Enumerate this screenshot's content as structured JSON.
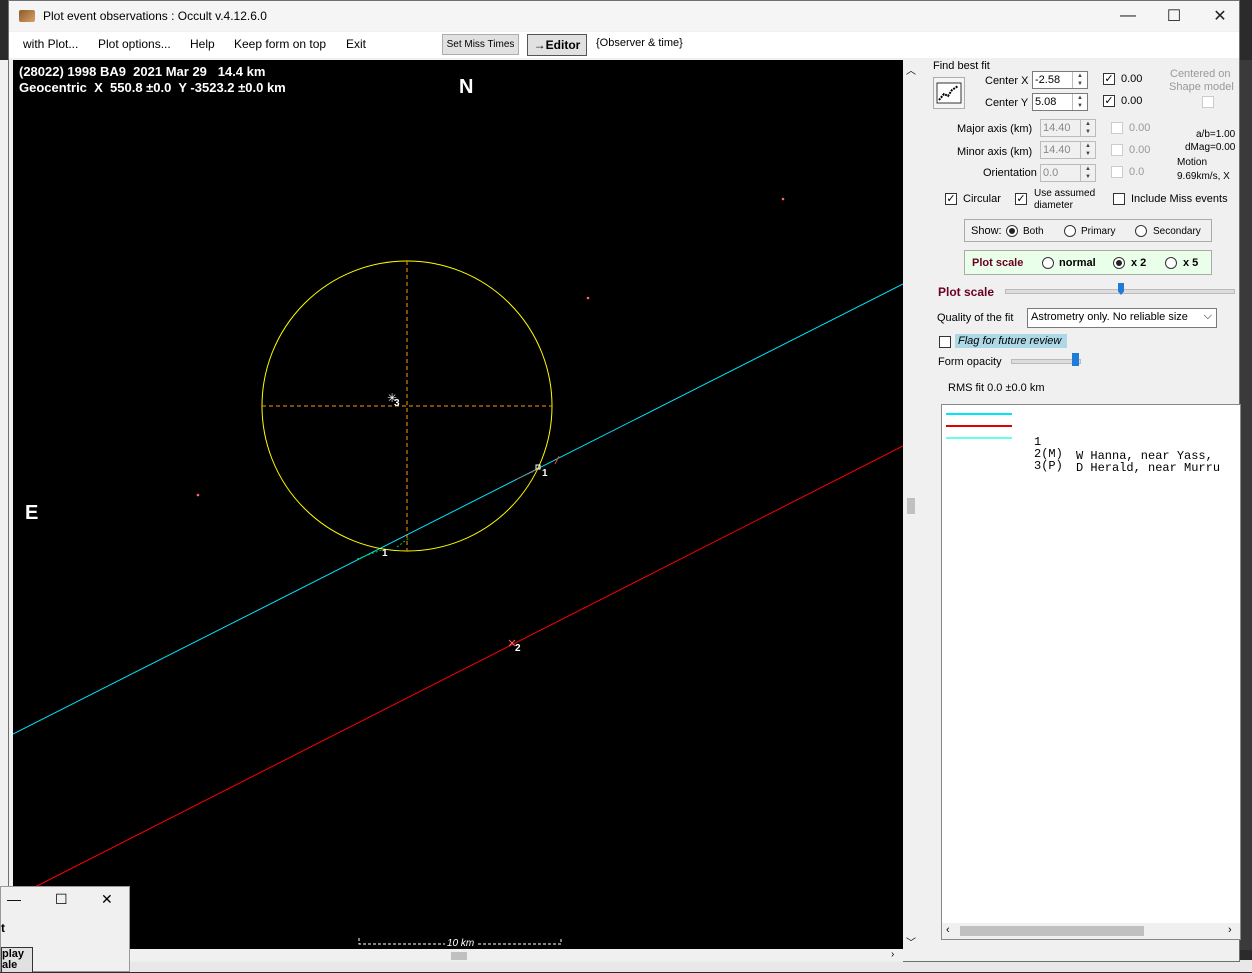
{
  "window": {
    "title": "Plot event observations : Occult v.4.12.6.0",
    "minimize": "—",
    "maximize": "☐",
    "close": "✕"
  },
  "menu": {
    "items": [
      "with Plot...",
      "Plot options...",
      "Help",
      "Keep form on top",
      "Exit"
    ],
    "set_miss_times": "Set Miss Times",
    "editor": "→Editor",
    "observer_time": "{Observer & time}"
  },
  "plot": {
    "header_line1": "(28022) 1998 BA9  2021 Mar 29   14.4 km",
    "header_line2": "Geocentric  X  550.8 ±0.0  Y -3523.2 ±0.0 km",
    "north_label": "N",
    "east_label": "E",
    "scale_label": "10 km",
    "chord_labels": [
      "1",
      "1",
      "2",
      "3"
    ],
    "background": "#000000",
    "ellipse_color": "#ffff00",
    "chord1_color": "#00e5ff",
    "chord2_color": "#ff0000"
  },
  "panel": {
    "find_best_fit": "Find best fit",
    "center_x_label": "Center X",
    "center_x_value": "-2.58",
    "center_x_fit": "0.00",
    "center_y_label": "Center Y",
    "center_y_value": "5.08",
    "center_y_fit": "0.00",
    "centered_on": "Centered on",
    "shape_model": "Shape model",
    "major_axis_label": "Major axis (km)",
    "major_axis_value": "14.40",
    "major_axis_fit": "0.00",
    "minor_axis_label": "Minor axis (km)",
    "minor_axis_value": "14.40",
    "minor_axis_fit": "0.00",
    "orientation_label": "Orientation",
    "orientation_value": "0.0",
    "orientation_fit": "0.0",
    "ab_ratio": "a/b=1.00",
    "dmag": "dMag=0.00",
    "motion_label": "Motion",
    "motion_value": "9.69km/s, X",
    "circular_label": "Circular",
    "use_assumed_line1": "Use assumed",
    "use_assumed_line2": "diameter",
    "include_miss": "Include Miss events",
    "show_label": "Show:",
    "show_both": "Both",
    "show_primary": "Primary",
    "show_secondary": "Secondary",
    "plot_scale_label": "Plot scale",
    "scale_normal": "normal",
    "scale_x2": "x 2",
    "scale_x5": "x 5",
    "plot_scale_slider_label": "Plot scale",
    "quality_label": "Quality of the fit",
    "quality_value": "Astrometry only. No reliable size",
    "flag_review": "Flag for future review",
    "form_opacity": "Form opacity",
    "rms_fit": "RMS fit 0.0 ±0.0 km",
    "legend": [
      {
        "num": "1    ",
        "text": "W Hanna, near Yass,",
        "color": "#00e5ff"
      },
      {
        "num": "2(M) ",
        "text": "D Herald, near Murru",
        "color": "#e00000"
      },
      {
        "num": "3(P) ",
        "text": "",
        "color": "#66ffee"
      }
    ]
  },
  "small_window": {
    "text1": "t",
    "button_line1": "play",
    "button_line2": "ale"
  }
}
